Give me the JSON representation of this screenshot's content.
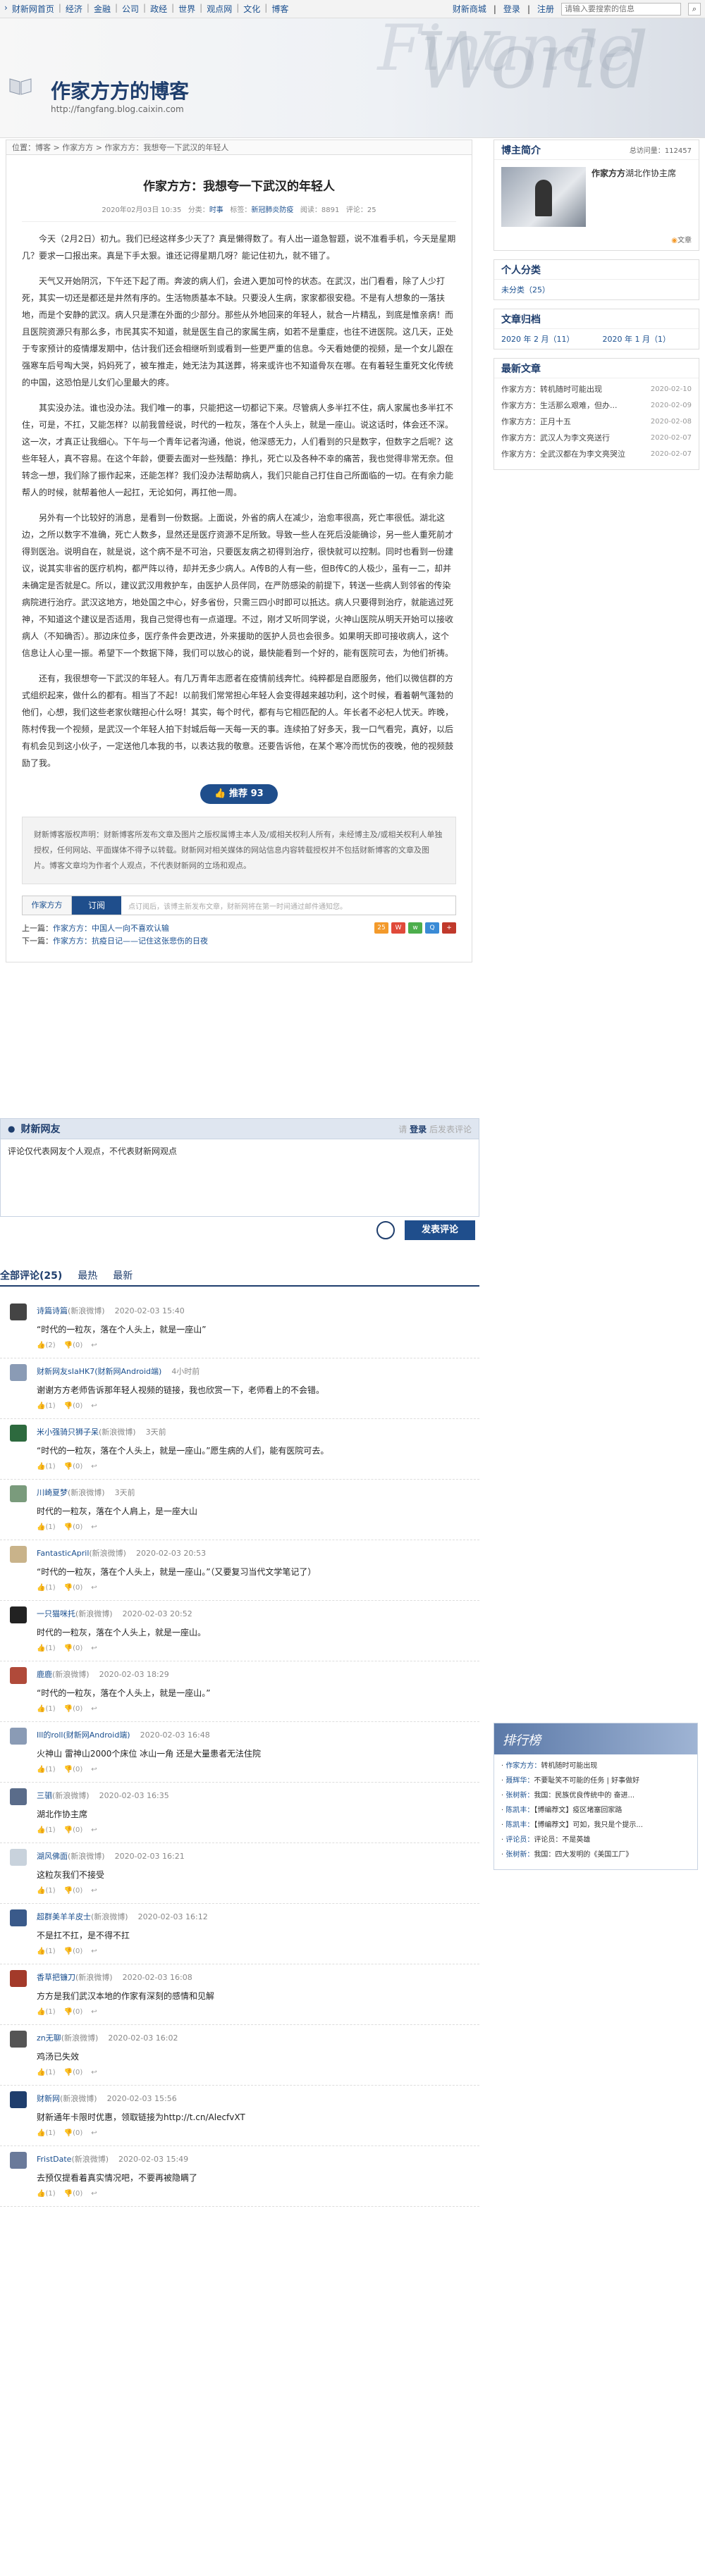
{
  "topnav": [
    "财新网首页",
    "经济",
    "金融",
    "公司",
    "政经",
    "世界",
    "观点网",
    "文化",
    "博客"
  ],
  "topright": {
    "mall": "财新商城",
    "login": "登录",
    "register": "注册",
    "search_placeholder": "请输入要搜索的信息"
  },
  "banner": {
    "title": "作家方方的博客",
    "url": "http://fangfang.blog.caixin.com",
    "bg_word1": "Finance",
    "bg_word2": "World"
  },
  "crumbs": "位置：博客 > 作家方方 > 作家方方：我想夸一下武汉的年轻人",
  "article": {
    "title": "作家方方：我想夸一下武汉的年轻人",
    "meta_date": "2020年02月03日 10:35",
    "meta_cat_label": "分类：",
    "meta_cat": "时事",
    "meta_tag_label": "标签：",
    "meta_tag": "新冠肺炎防疫",
    "meta_read": "阅读：8891",
    "meta_comment": "评论：25",
    "paras": [
      "今天（2月2日）初九。我们已经这样多少天了？真是懒得数了。有人出一道急智题，说不准看手机，今天是星期几？要求一口报出来。真是下手太狠。谁还记得星期几呀？能记住初九，就不错了。",
      "天气又开始阴沉，下午还下起了雨。奔波的病人们，会进入更加可怜的状态。在武汉，出门看看，除了人少打死，其实一切还是都还是井然有序的。生活物质基本不缺。只要没人生病，家家都很安稳。不是有人想象的一落扶地，而是个安静的武汉。病人只是漂在外面的少部分。那些从外地回来的年轻人，就合一片精乱，到底是惟亲病！而且医院资源只有那么多，市民其实不知道，就是医生自己的家属生病，如若不是重症，也往不进医院。这几天，正处于专家预计的疫情爆发期中，估计我们还会相继听到或看到一些更严重的信息。今天看她便的视频，是一个女儿跟在强寒车后号啕大哭，妈妈死了，被车推走，她无法为其送葬，将来或许也不知道骨灰在哪。在有着轻生重死文化传统的中国，这恐怕是儿女们心里最大的疼。",
      "其实没办法。谁也没办法。我们唯一的事，只能把这一切都记下来。尽管病人多半扛不住，病人家属也多半扛不住，可是，不扛，又能怎样？以前我曾经说，时代的一粒灰，落在个人头上，就是一座山。说这话时，体会还不深。这一次，才真正让我细心。下午与一个青年记者沟通，他说，他深感无力，人们看到的只是数字，但数字之后呢？这些年轻人，真不容易。在这个年龄，便要去面对一些残酷：挣扎，死亡以及各种不幸的痛苦，我也觉得非常无奈。但转念一想，我们除了振作起来，还能怎样？我们没办法帮助病人，我们只能自己打住自己所面临的一切。在有余力能帮人的时候，就帮着他人一起扛，无论如何，再扛他一周。",
      "另外有一个比较好的消息，是看到一份数据。上面说，外省的病人在减少，治愈率很高，死亡率很低。湖北这边，之所以数字不准确，死亡人数多，显然还是医疗资源不足所致。导致一些人在死后没能确诊，另一些人重死前才得到医治。说明自在，就是说，这个病不是不可治，只要医友病之初得到治疗，很快就可以控制。同时也看到一份建议，说其实非省的医疗机构，都严阵以待，却并无多少病人。A传B的人有一些，但B传C的人极少，虽有一二，却并未确定是否就是C。所以，建议武汉用救护车，由医护人员伴同，在严防感染的前提下，转送一些病人到邻省的传染病院进行治疗。武汉这地方，地处国之中心，好多省份，只需三四小时即可以抵达。病人只要得到治疗，就能逃过死神，不知道这个建议是否适用，我自己觉得也有一点道理。不过，刚才又听同学说，火神山医院从明天开始可以接收病人（不知确否）。那边床位多，医疗条件会更改进，外来援助的医护人员也会很多。如果明天即可接收病人，这个信息让人心里一振。希望下一个数据下降，我们可以放心的说，最快能看到一个好的，能有医院可去，为他们祈祷。",
      "还有，我很想夸一下武汉的年轻人。有几万青年志愿者在疫情前线奔忙。纯粹都是自愿服务，他们以微信群的方式组织起来，做什么的都有。相当了不起！以前我们常常担心年轻人会变得越来越功利，这个时候，看着朝气蓬勃的他们，心想，我们这些老家伙瞎担心什么呀！其实，每个时代，都有与它相匹配的人。年长者不必杞人忧天。昨晚，陈村传我一个视频，是武汉一个年轻人拍下封城后每一天每一天的事。连续拍了好多天，我一口气看完，真好，以后有机会见到这小伙子，一定送他几本我的书，以表达我的敬意。还要告诉他，在某个寒冷而忧伤的夜晚，他的视频鼓励了我。"
    ],
    "recommend": "推荐 93",
    "notice": "财新博客版权声明：财新博客所发布文章及图片之版权属博主本人及/或相关权利人所有，未经博主及/或相关权利人单独授权，任何网站、平面媒体不得予以转载。财新网对相关媒体的网站信息内容转载授权并不包括财新博客的文章及图片。博客文章均为作者个人观点，不代表财新网的立场和观点。",
    "sub_name": "作家方方",
    "sub_btn": "订阅",
    "sub_hint": "点订阅后，该博主新发布文章，财新网将在第一时间通过邮件通知您。",
    "prev_label": "上一篇：",
    "prev": "作家方方：中国人一向不喜欢认输",
    "next_label": "下一篇：",
    "next": "作家方方：抗疫日记——记住这张悲伤的日夜",
    "share_count": "25"
  },
  "side": {
    "profile_title": "博主简介",
    "visits_label": "总访问量：",
    "visits": "112457",
    "name": "作家方方",
    "desc": "湖北作协主席",
    "more": "文章",
    "cat_title": "个人分类",
    "cat_item": "未分类（25）",
    "arch_title": "文章归档",
    "arch": [
      "2020 年 2 月（11）",
      "2020 年 1 月（1）"
    ],
    "new_title": "最新文章",
    "new_items": [
      {
        "t": "作家方方：转机随时可能出现",
        "d": "2020-02-10"
      },
      {
        "t": "作家方方：生活那么艰难，但办...",
        "d": "2020-02-09"
      },
      {
        "t": "作家方方：正月十五",
        "d": "2020-02-08"
      },
      {
        "t": "作家方方：武汉人为李文亮送行",
        "d": "2020-02-07"
      },
      {
        "t": "作家方方：全武汉都在为李文亮哭泣",
        "d": "2020-02-07"
      }
    ]
  },
  "comment": {
    "title": "财新网友",
    "login": "登录",
    "prefix": "请",
    "suffix": "后发表评论",
    "text": "评论仅代表网友个人观点，不代表财新网观点",
    "post": "发表评论"
  },
  "tabs": {
    "all": "全部评论(25)",
    "hot": "最热",
    "new": "最新"
  },
  "comments": [
    {
      "user": "诗篇诗篇",
      "src": "(新浪微博)",
      "time": "2020-02-03 15:40",
      "text": "“时代的一粒灰，落在个人头上，就是一座山”",
      "up": "(2)",
      "down": "(0)",
      "color": "#444"
    },
    {
      "user": "财新网友sIaHK7(财新网Android端)",
      "src": "",
      "time": "4小时前",
      "text": "谢谢方方老师告诉那年轻人视频的链接，我也欣赏一下，老师看上的不会错。",
      "up": "(1)",
      "down": "(0)",
      "color": "#8a9bb5"
    },
    {
      "user": "米小强骑只狮子呆",
      "src": "(新浪微博)",
      "time": "3天前",
      "text": "“时代的一粒灰，落在个人头上，就是一座山。”愿生病的人们，能有医院可去。",
      "up": "(1)",
      "down": "(0)",
      "color": "#2d6a3e"
    },
    {
      "user": "川崎夏梦",
      "src": "(新浪微博)",
      "time": "3天前",
      "text": "时代的一粒灰，落在个人肩上，是一座大山",
      "up": "(1)",
      "down": "(0)",
      "color": "#7a9b7c"
    },
    {
      "user": "FantasticApril",
      "src": "(新浪微博)",
      "time": "2020-02-03 20:53",
      "text": "“时代的一粒灰，落在个人头上，就是一座山。”（又要复习当代文学笔记了）",
      "up": "(1)",
      "down": "(0)",
      "color": "#c9b38a"
    },
    {
      "user": "一只猫咪托",
      "src": "(新浪微博)",
      "time": "2020-02-03 20:52",
      "text": "时代的一粒灰，落在个人头上，就是一座山。",
      "up": "(1)",
      "down": "(0)",
      "color": "#222"
    },
    {
      "user": "鹿鹿",
      "src": "(新浪微博)",
      "time": "2020-02-03 18:29",
      "text": "“时代的一粒灰，落在个人头上，就是一座山。”",
      "up": "(1)",
      "down": "(0)",
      "color": "#b04a3a"
    },
    {
      "user": "Ill的roll(财新网Android端)",
      "src": "",
      "time": "2020-02-03 16:48",
      "text": "火神山 雷神山2000个床位 冰山一角 还是大量患者无法住院",
      "up": "(1)",
      "down": "(0)",
      "color": "#8a9bb5"
    },
    {
      "user": "三驷",
      "src": "(新浪微博)",
      "time": "2020-02-03 16:35",
      "text": "湖北作协主席",
      "up": "(1)",
      "down": "(0)",
      "color": "#5a6c8a"
    },
    {
      "user": "湖风佛面",
      "src": "(新浪微博)",
      "time": "2020-02-03 16:21",
      "text": "这粒灰我们不接受",
      "up": "(1)",
      "down": "(0)",
      "color": "#c8d2dc"
    },
    {
      "user": "超群美羊羊皮士",
      "src": "(新浪微博)",
      "time": "2020-02-03 16:12",
      "text": "不是扛不扛，是不得不扛",
      "up": "(1)",
      "down": "(0)",
      "color": "#3a5a8a"
    },
    {
      "user": "香草把镰刀",
      "src": "(新浪微博)",
      "time": "2020-02-03 16:08",
      "text": "方方是我们武汉本地的作家有深刻的感情和见解",
      "up": "(1)",
      "down": "(0)",
      "color": "#a33a2a"
    },
    {
      "user": "zn无聊",
      "src": "(新浪微博)",
      "time": "2020-02-03 16:02",
      "text": "鸡汤已失效",
      "up": "(1)",
      "down": "(0)",
      "color": "#555"
    },
    {
      "user": "财新网",
      "src": "(新浪微博)",
      "time": "2020-02-03 15:56",
      "text": "财新通年卡限时优惠，领取链接为http://t.cn/AlecfvXT",
      "up": "(1)",
      "down": "(0)",
      "color": "#1f3e6d"
    },
    {
      "user": "FristDate",
      "src": "(新浪微博)",
      "time": "2020-02-03 15:49",
      "text": "去预仅提看着真实情况吧，不要再被隐瞒了",
      "up": "(1)",
      "down": "(0)",
      "color": "#6a7a9a"
    }
  ],
  "hot": {
    "title": "排行榜",
    "items": [
      {
        "who": "作家方方：",
        "t": "转机随时可能出现"
      },
      {
        "who": "聂辉华：",
        "t": "不要耻笑不可能的任务 | 好事做好"
      },
      {
        "who": "张树新：",
        "t": "我国：民族优良传统中的 奋进..."
      },
      {
        "who": "陈凯丰：",
        "t": "【博编荐文】疫区堵塞回家路"
      },
      {
        "who": "陈凯丰：",
        "t": "【博编荐文】可如，我只是个提示..."
      },
      {
        "who": "评论员：",
        "t": "评论员：不是英雄"
      },
      {
        "who": "张树新：",
        "t": "我国：四大发明的《美国工厂》"
      }
    ]
  }
}
